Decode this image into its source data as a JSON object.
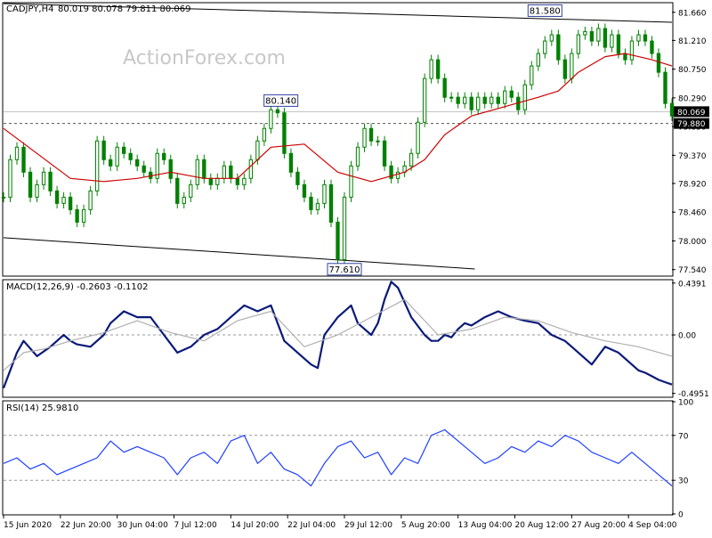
{
  "header": {
    "symbol": "CADJPY,H4",
    "ohlc": "80.019 80.078 79.811 80.069"
  },
  "watermark": "ActionForex.com",
  "colors": {
    "candle": "#008000",
    "ma": "#cc0000",
    "macd": "#0a1a7a",
    "signal": "#b0b0b0",
    "rsi": "#1e3fff",
    "trendline": "#000000",
    "price_box_bg": "#ffffff",
    "tag_bg": "#000000"
  },
  "chart_data": [
    {
      "type": "line",
      "panel": "price",
      "title": "CADJPY,H4 80.019 80.078 79.811 80.069",
      "ylim": [
        77.45,
        81.8
      ],
      "y_ticks": [
        "81.660",
        "81.210",
        "80.750",
        "80.290",
        "79.830",
        "79.370",
        "78.920",
        "78.460",
        "78.000",
        "77.540"
      ],
      "price_tags": [
        "80.069",
        "79.880"
      ],
      "annotations": [
        {
          "text": "81.580",
          "x": 0.81,
          "value": 81.58
        },
        {
          "text": "80.140",
          "x": 0.415,
          "value": 80.14
        },
        {
          "text": "77.610",
          "x": 0.51,
          "value": 77.61
        }
      ],
      "horizontal_lines": [
        80.069,
        79.88
      ],
      "trendlines": [
        {
          "points": [
            [
              0.0,
              81.8
            ],
            [
              1.0,
              81.5
            ]
          ]
        },
        {
          "points": [
            [
              0.0,
              78.05
            ],
            [
              0.705,
              77.55
            ]
          ]
        }
      ],
      "series": [
        {
          "role": "price",
          "x": [
            0,
            0.01,
            0.02,
            0.03,
            0.04,
            0.05,
            0.06,
            0.07,
            0.08,
            0.09,
            0.1,
            0.11,
            0.12,
            0.13,
            0.14,
            0.15,
            0.16,
            0.17,
            0.18,
            0.19,
            0.2,
            0.21,
            0.22,
            0.23,
            0.24,
            0.25,
            0.26,
            0.27,
            0.28,
            0.29,
            0.3,
            0.31,
            0.32,
            0.33,
            0.34,
            0.35,
            0.36,
            0.37,
            0.38,
            0.39,
            0.4,
            0.41,
            0.42,
            0.43,
            0.44,
            0.45,
            0.46,
            0.47,
            0.48,
            0.49,
            0.5,
            0.51,
            0.52,
            0.53,
            0.54,
            0.55,
            0.56,
            0.57,
            0.58,
            0.59,
            0.6,
            0.61,
            0.62,
            0.63,
            0.64,
            0.65,
            0.66,
            0.67,
            0.68,
            0.69,
            0.7,
            0.71,
            0.72,
            0.73,
            0.74,
            0.75,
            0.76,
            0.77,
            0.78,
            0.79,
            0.8,
            0.81,
            0.82,
            0.83,
            0.84,
            0.85,
            0.86,
            0.87,
            0.88,
            0.89,
            0.9,
            0.91,
            0.92,
            0.93,
            0.94,
            0.95,
            0.96,
            0.97,
            0.98,
            0.99,
            1.0
          ],
          "values": [
            78.7,
            79.3,
            79.5,
            79.1,
            78.7,
            78.9,
            79.1,
            78.8,
            78.6,
            78.7,
            78.5,
            78.3,
            78.5,
            78.8,
            79.6,
            79.3,
            79.2,
            79.5,
            79.4,
            79.3,
            79.2,
            79.1,
            79.0,
            79.4,
            79.3,
            79.0,
            78.6,
            78.7,
            78.9,
            79.3,
            79.0,
            78.9,
            79.0,
            79.2,
            79.0,
            78.9,
            79.0,
            79.3,
            79.6,
            79.8,
            80.1,
            80.05,
            79.4,
            79.1,
            78.9,
            78.7,
            78.5,
            78.6,
            78.9,
            78.3,
            77.7,
            78.7,
            79.2,
            79.5,
            79.8,
            79.6,
            79.6,
            79.2,
            79.0,
            79.1,
            79.2,
            79.4,
            79.9,
            80.6,
            80.9,
            80.6,
            80.3,
            80.3,
            80.2,
            80.3,
            80.1,
            80.3,
            80.2,
            80.3,
            80.2,
            80.4,
            80.3,
            80.1,
            80.5,
            80.8,
            81.0,
            81.2,
            81.3,
            80.9,
            80.6,
            81.0,
            81.3,
            81.35,
            81.2,
            81.4,
            81.1,
            81.3,
            81.0,
            80.9,
            81.2,
            81.3,
            81.2,
            81.0,
            80.7,
            80.2,
            80.0
          ]
        },
        {
          "role": "ma",
          "x": [
            0,
            0.05,
            0.1,
            0.15,
            0.2,
            0.25,
            0.3,
            0.35,
            0.4,
            0.45,
            0.5,
            0.55,
            0.6,
            0.63,
            0.66,
            0.7,
            0.75,
            0.8,
            0.83,
            0.86,
            0.9,
            0.93,
            0.97,
            1.0
          ],
          "values": [
            79.8,
            79.4,
            79.0,
            78.95,
            79.0,
            79.1,
            79.0,
            79.0,
            79.5,
            79.55,
            79.1,
            78.95,
            79.1,
            79.3,
            79.7,
            80.0,
            80.15,
            80.3,
            80.4,
            80.7,
            80.95,
            81.0,
            80.9,
            80.8
          ]
        }
      ]
    },
    {
      "type": "line",
      "panel": "macd",
      "title": "MACD(12,26,9) -0.2603 -0.1102",
      "ylim": [
        -0.52,
        0.46
      ],
      "y_ticks": [
        "0.4391",
        "0.00",
        "-0.4951"
      ],
      "series": [
        {
          "role": "macd",
          "x": [
            0,
            0.01,
            0.02,
            0.03,
            0.05,
            0.07,
            0.09,
            0.1,
            0.11,
            0.13,
            0.15,
            0.16,
            0.18,
            0.2,
            0.22,
            0.24,
            0.26,
            0.28,
            0.3,
            0.32,
            0.34,
            0.36,
            0.38,
            0.4,
            0.42,
            0.44,
            0.45,
            0.46,
            0.47,
            0.48,
            0.5,
            0.52,
            0.53,
            0.55,
            0.56,
            0.57,
            0.58,
            0.59,
            0.61,
            0.63,
            0.64,
            0.65,
            0.66,
            0.67,
            0.68,
            0.69,
            0.7,
            0.72,
            0.74,
            0.76,
            0.78,
            0.8,
            0.81,
            0.82,
            0.84,
            0.85,
            0.86,
            0.87,
            0.88,
            0.9,
            0.92,
            0.93,
            0.94,
            0.95,
            0.96,
            0.97,
            0.98,
            0.99,
            1.0
          ],
          "values": [
            -0.45,
            -0.3,
            -0.15,
            -0.05,
            -0.18,
            -0.1,
            0.0,
            -0.05,
            -0.08,
            -0.1,
            0.0,
            0.1,
            0.2,
            0.15,
            0.15,
            0.0,
            -0.15,
            -0.1,
            0.0,
            0.05,
            0.15,
            0.25,
            0.2,
            0.25,
            -0.05,
            -0.15,
            -0.2,
            -0.25,
            -0.28,
            0.0,
            0.15,
            0.25,
            0.1,
            0.0,
            0.1,
            0.3,
            0.45,
            0.4,
            0.15,
            0.0,
            -0.05,
            -0.05,
            0.0,
            -0.02,
            0.05,
            0.1,
            0.08,
            0.15,
            0.2,
            0.15,
            0.12,
            0.1,
            0.05,
            0.0,
            -0.05,
            -0.1,
            -0.15,
            -0.2,
            -0.25,
            -0.1,
            -0.15,
            -0.2,
            -0.25,
            -0.3,
            -0.32,
            -0.35,
            -0.38,
            -0.4,
            -0.42
          ]
        },
        {
          "role": "signal",
          "x": [
            0,
            0.03,
            0.06,
            0.1,
            0.15,
            0.2,
            0.25,
            0.3,
            0.35,
            0.4,
            0.45,
            0.5,
            0.55,
            0.6,
            0.65,
            0.7,
            0.75,
            0.8,
            0.85,
            0.9,
            0.95,
            1.0
          ],
          "values": [
            -0.3,
            -0.15,
            -0.12,
            -0.05,
            0.02,
            0.12,
            0.02,
            -0.05,
            0.12,
            0.2,
            -0.1,
            0.0,
            0.15,
            0.3,
            0.0,
            0.05,
            0.15,
            0.12,
            0.02,
            -0.05,
            -0.1,
            -0.18
          ]
        }
      ]
    },
    {
      "type": "line",
      "panel": "rsi",
      "title": "RSI(14) 25.9810",
      "ylim": [
        0,
        100
      ],
      "y_ticks": [
        "100",
        "70",
        "30",
        "0"
      ],
      "levels": [
        70,
        30
      ],
      "series": [
        {
          "role": "rsi",
          "x": [
            0,
            0.02,
            0.04,
            0.06,
            0.08,
            0.1,
            0.12,
            0.14,
            0.16,
            0.18,
            0.2,
            0.22,
            0.24,
            0.26,
            0.28,
            0.3,
            0.32,
            0.34,
            0.36,
            0.38,
            0.4,
            0.42,
            0.44,
            0.46,
            0.48,
            0.5,
            0.52,
            0.54,
            0.56,
            0.58,
            0.6,
            0.62,
            0.64,
            0.66,
            0.68,
            0.7,
            0.72,
            0.74,
            0.76,
            0.78,
            0.8,
            0.82,
            0.84,
            0.86,
            0.88,
            0.9,
            0.92,
            0.94,
            0.96,
            0.98,
            1.0
          ],
          "values": [
            45,
            50,
            40,
            45,
            35,
            40,
            45,
            50,
            65,
            55,
            60,
            55,
            50,
            35,
            50,
            55,
            45,
            65,
            70,
            45,
            55,
            40,
            35,
            25,
            45,
            60,
            65,
            50,
            55,
            35,
            50,
            45,
            70,
            75,
            65,
            55,
            45,
            50,
            60,
            55,
            65,
            60,
            70,
            65,
            55,
            50,
            45,
            55,
            45,
            35,
            25
          ]
        }
      ]
    }
  ],
  "x_axis": {
    "labels": [
      "15 Jun 2020",
      "22 Jun 20:00",
      "30 Jun 04:00",
      "7 Jul 12:00",
      "14 Jul 20:00",
      "22 Jul 04:00",
      "29 Jul 12:00",
      "5 Aug 20:00",
      "13 Aug 04:00",
      "20 Aug 12:00",
      "27 Aug 20:00",
      "4 Sep 04:00"
    ],
    "positions": [
      0.0,
      0.085,
      0.17,
      0.255,
      0.34,
      0.425,
      0.51,
      0.595,
      0.68,
      0.765,
      0.85,
      0.935
    ]
  }
}
